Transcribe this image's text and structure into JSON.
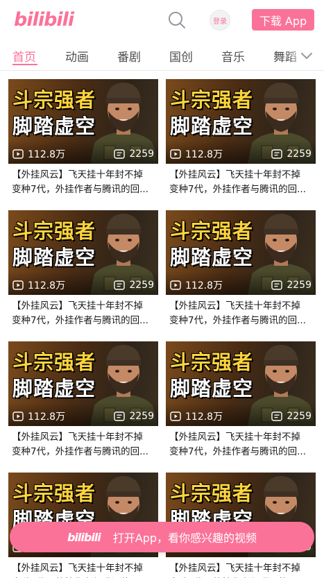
{
  "header": {
    "logo": "bilibili",
    "login_label": "登录",
    "download_label": "下载 App"
  },
  "tabs": [
    "首页",
    "动画",
    "番剧",
    "国创",
    "音乐",
    "舞蹈"
  ],
  "active_tab": 0,
  "video": {
    "thumb_line1": "斗宗强者",
    "thumb_line2": "脚踏虚空",
    "play_count": "112.8万",
    "danmaku_count": "2259",
    "caption_line1": "【外挂风云】飞天挂十年封不掉",
    "caption_line2": "变种7代，外挂作者与腾讯的回..."
  },
  "banner": {
    "logo": "bilibili",
    "text": "打开App，看你感兴趣的视频"
  },
  "colors": {
    "brand": "#fb7299",
    "title_yellow": "#ffd43d"
  }
}
